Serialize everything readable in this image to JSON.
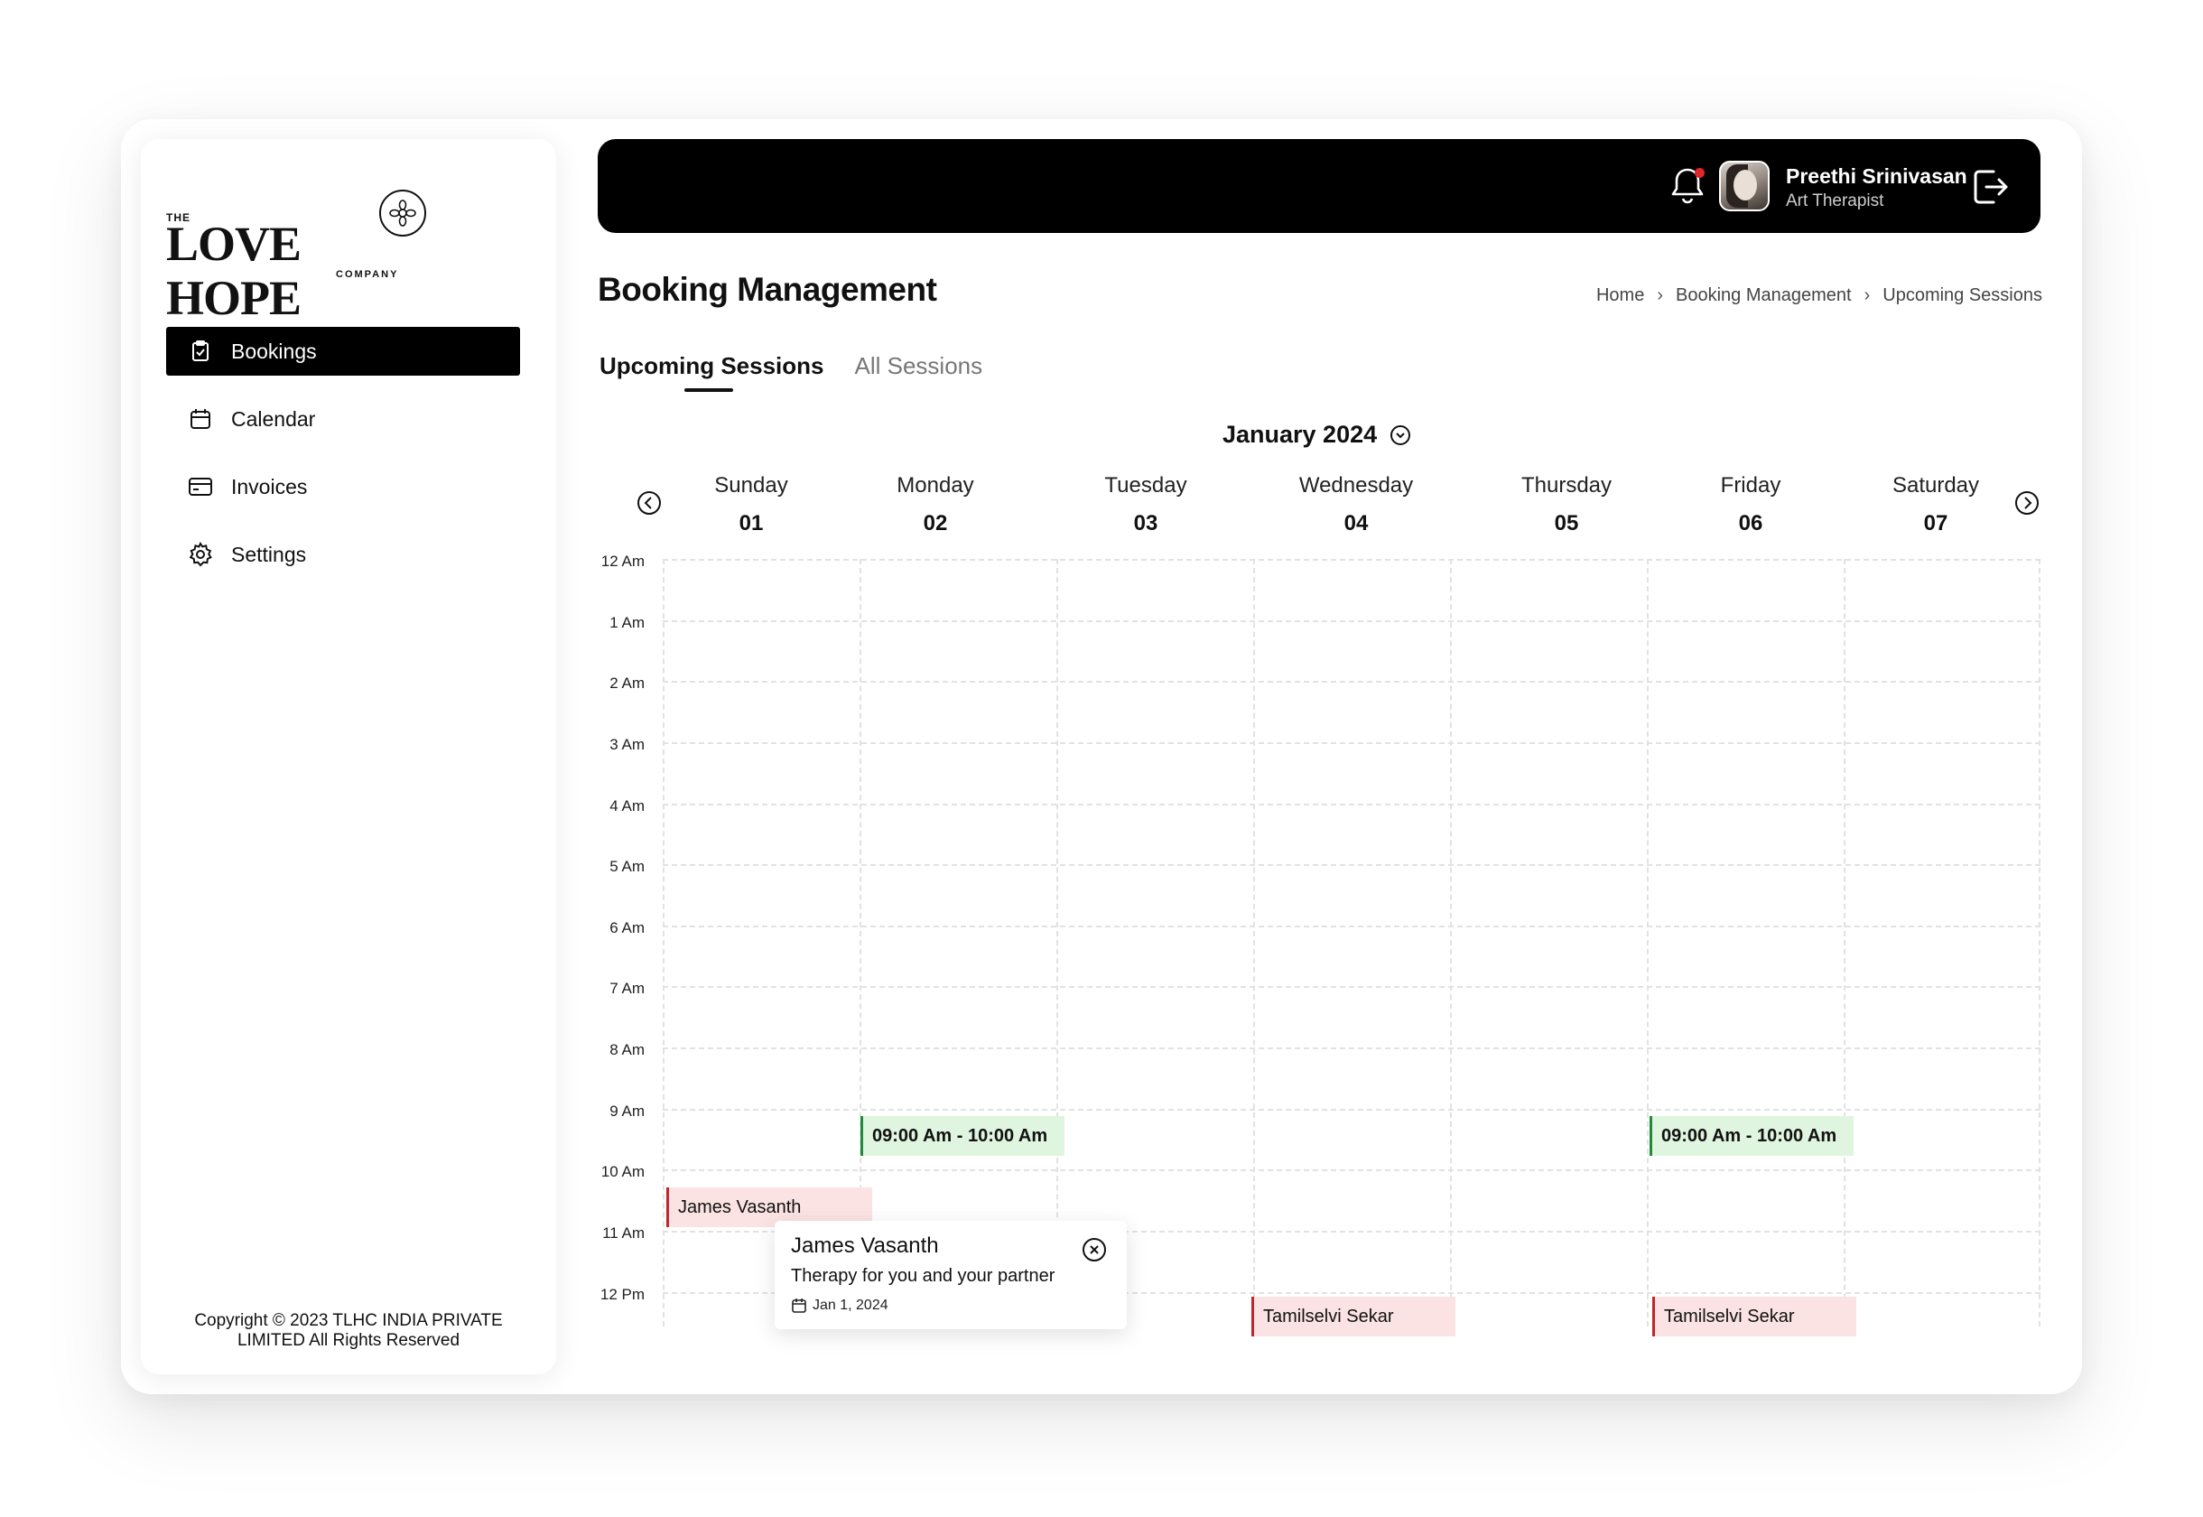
{
  "brand": {
    "the": "THE",
    "name": "LOVE HOPE",
    "company": "COMPANY"
  },
  "sidebar": {
    "items": [
      {
        "label": "Bookings",
        "icon": "clipboard-check-icon",
        "active": true
      },
      {
        "label": "Calendar",
        "icon": "calendar-icon",
        "active": false
      },
      {
        "label": "Invoices",
        "icon": "credit-card-icon",
        "active": false
      },
      {
        "label": "Settings",
        "icon": "gear-icon",
        "active": false
      }
    ],
    "copyright_line1": "Copyright © 2023 TLHC INDIA PRIVATE",
    "copyright_line2": "LIMITED All Rights Reserved"
  },
  "header": {
    "user_name": "Preethi Srinivasan",
    "user_role": "Art Therapist",
    "notification_dot_color": "#e0262b"
  },
  "page": {
    "title": "Booking Management",
    "breadcrumb": [
      "Home",
      "Booking Management",
      "Upcoming Sessions"
    ],
    "tabs": [
      {
        "label": "Upcoming Sessions",
        "active": true
      },
      {
        "label": "All Sessions",
        "active": false
      }
    ]
  },
  "calendar": {
    "month_label": "January 2024",
    "days": [
      {
        "name": "Sunday",
        "num": "01"
      },
      {
        "name": "Monday",
        "num": "02"
      },
      {
        "name": "Tuesday",
        "num": "03"
      },
      {
        "name": "Wednesday",
        "num": "04"
      },
      {
        "name": "Thursday",
        "num": "05"
      },
      {
        "name": "Friday",
        "num": "06"
      },
      {
        "name": "Saturday",
        "num": "07"
      }
    ],
    "times": [
      "12 Am",
      "1 Am",
      "2 Am",
      "3 Am",
      "4 Am",
      "5 Am",
      "6 Am",
      "7 Am",
      "8 Am",
      "9 Am",
      "10 Am",
      "11 Am",
      "12 Pm"
    ],
    "events": [
      {
        "label": "09:00 Am - 10:00 Am",
        "type": "available",
        "day": "Monday"
      },
      {
        "label": "09:00 Am - 10:00 Am",
        "type": "available",
        "day": "Friday"
      },
      {
        "label": "James Vasanth",
        "type": "booked",
        "day": "Sunday"
      },
      {
        "label": "Tamilselvi Sekar",
        "type": "booked",
        "day": "Wednesday"
      },
      {
        "label": "Tamilselvi Sekar",
        "type": "booked",
        "day": "Friday"
      }
    ],
    "popup": {
      "name": "James Vasanth",
      "session": "Therapy for you and your partner",
      "date": "Jan 1, 2024"
    }
  },
  "colors": {
    "available_bg": "#dff5df",
    "available_border": "#1f8a3a",
    "booked_bg": "#fbe3e3",
    "booked_border": "#c0262b"
  }
}
